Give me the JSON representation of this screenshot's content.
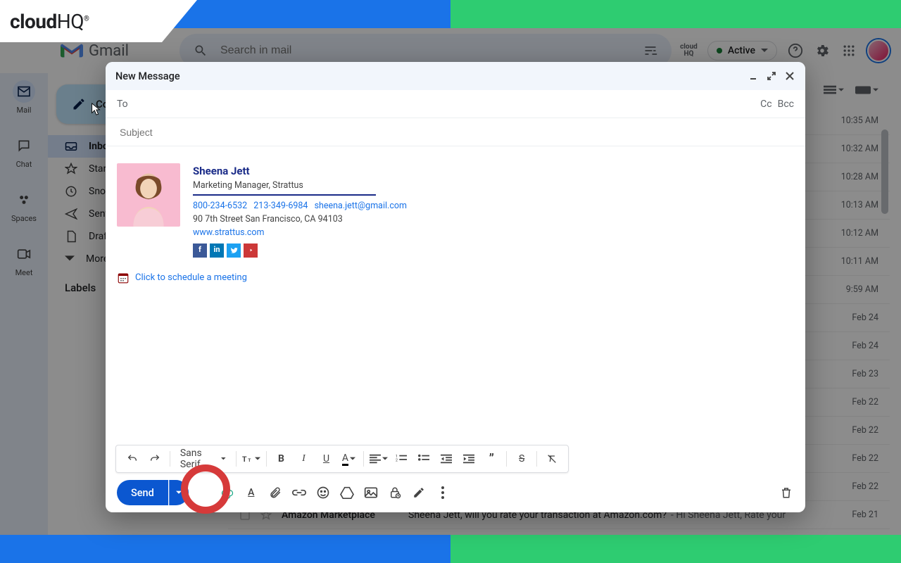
{
  "badge": {
    "brand": "cloud",
    "brand2": "HQ"
  },
  "gmail": {
    "name": "Gmail"
  },
  "search": {
    "placeholder": "Search in mail"
  },
  "active": {
    "label": "Active"
  },
  "rail": [
    {
      "label": "Mail"
    },
    {
      "label": "Chat"
    },
    {
      "label": "Spaces"
    },
    {
      "label": "Meet"
    }
  ],
  "compose_button": "Compose",
  "sidebar": [
    {
      "label": "Inbox",
      "sel": true
    },
    {
      "label": "Starred"
    },
    {
      "label": "Snoozed"
    },
    {
      "label": "Sent"
    },
    {
      "label": "Drafts"
    },
    {
      "label": "More"
    }
  ],
  "labels_head": "Labels",
  "times": [
    "10:35 AM",
    "10:32 AM",
    "10:28 AM",
    "10:13 AM",
    "10:12 AM",
    "10:11 AM",
    "9:59 AM",
    "Feb 24",
    "Feb 24",
    "Feb 23",
    "Feb 22",
    "Feb 22",
    "Feb 22",
    "Feb 22",
    "Feb 21"
  ],
  "last_row": {
    "sender": "Amazon Marketplace",
    "subject": "Sheena Jett, will you rate your transaction at Amazon.com?",
    "snippet": "Hi Sheena Jett, Rate your"
  },
  "compose": {
    "title": "New Message",
    "to": "To",
    "cc": "Cc",
    "bcc": "Bcc",
    "subject": "Subject"
  },
  "signature": {
    "name": "Sheena Jett",
    "title": "Marketing Manager, Strattus",
    "phone1": "800-234-6532",
    "phone2": "213-349-6984",
    "email": "sheena.jett@gmail.com",
    "addr": "90 7th Street San Francisco, CA 94103",
    "web": "www.strattus.com",
    "meeting": "Click to schedule a meeting"
  },
  "format": {
    "font": "Sans Serif"
  },
  "send": "Send"
}
